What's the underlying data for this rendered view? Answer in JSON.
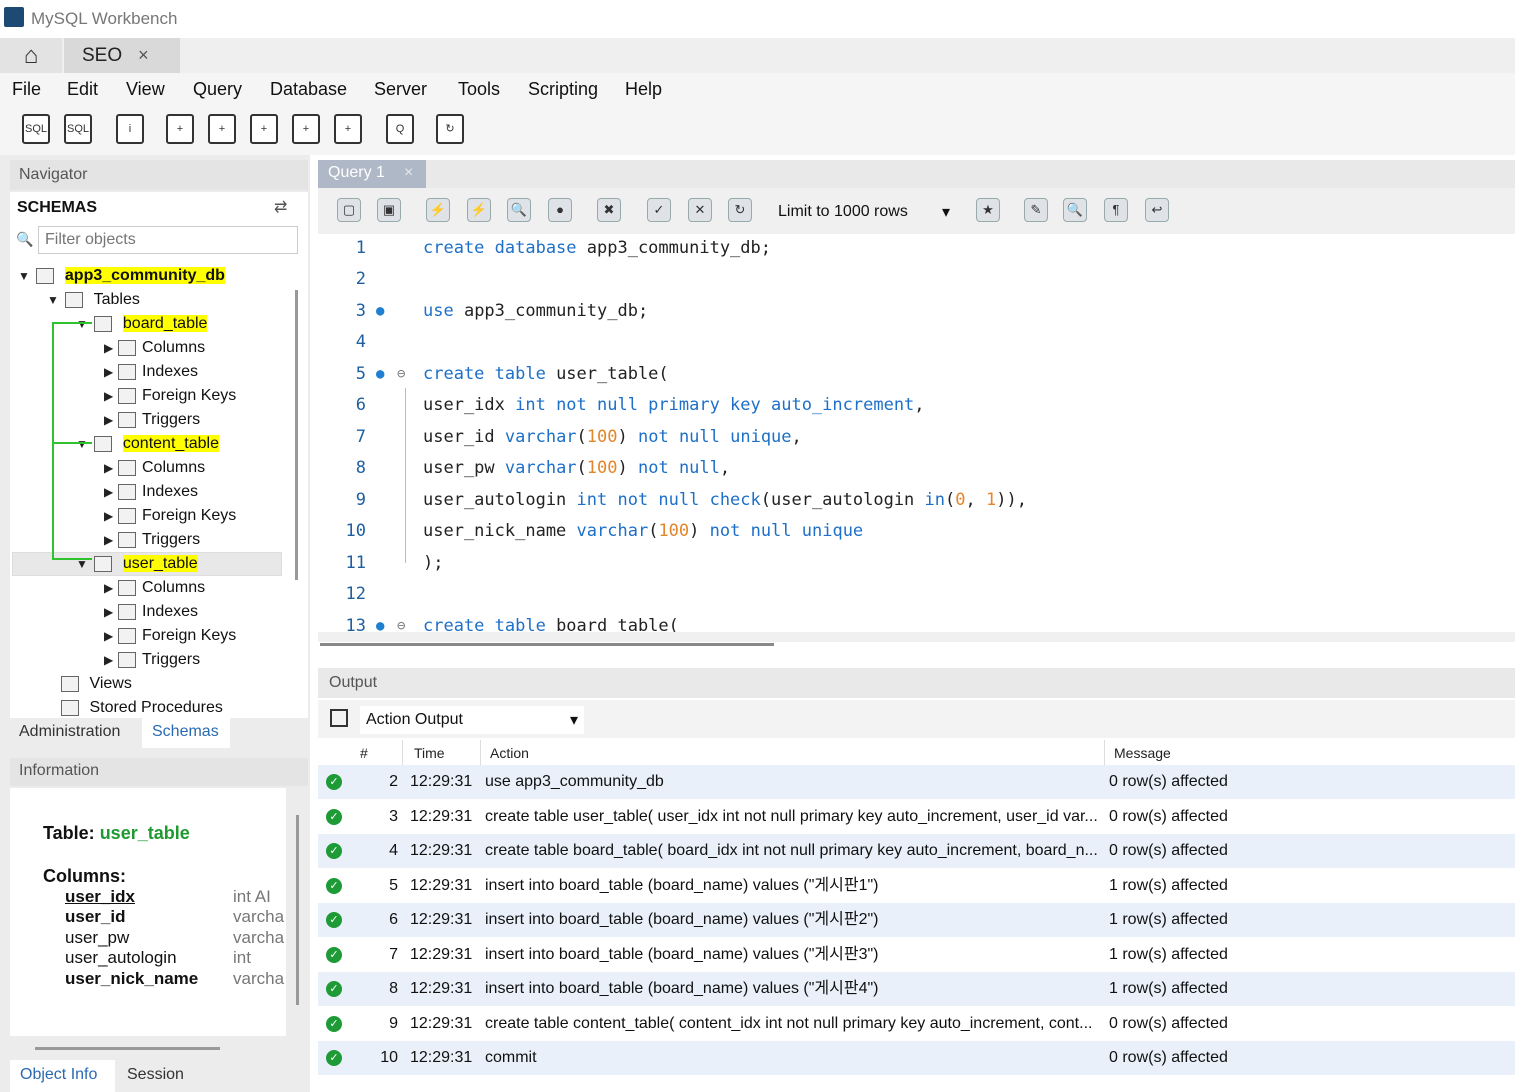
{
  "window": {
    "title": "MySQL Workbench"
  },
  "tabs": {
    "home_icon": "home-icon",
    "connection_tab": "SEO",
    "close_glyph": "×"
  },
  "menu": [
    "File",
    "Edit",
    "View",
    "Query",
    "Database",
    "Server",
    "Tools",
    "Scripting",
    "Help"
  ],
  "navigator": {
    "title": "Navigator",
    "schemas_title": "SCHEMAS",
    "filter_placeholder": "Filter objects",
    "tree": {
      "schema": "app3_community_db",
      "tables_label": "Tables",
      "tables": [
        {
          "name": "board_table",
          "children": [
            "Columns",
            "Indexes",
            "Foreign Keys",
            "Triggers"
          ]
        },
        {
          "name": "content_table",
          "children": [
            "Columns",
            "Indexes",
            "Foreign Keys",
            "Triggers"
          ]
        },
        {
          "name": "user_table",
          "children": [
            "Columns",
            "Indexes",
            "Foreign Keys",
            "Triggers"
          ]
        }
      ],
      "views_label": "Views",
      "procedures_label": "Stored Procedures"
    },
    "tabs": {
      "administration": "Administration",
      "schemas": "Schemas"
    }
  },
  "information": {
    "title": "Information",
    "table_prefix": "Table:",
    "table_name": "user_table",
    "columns_label": "Columns:",
    "columns": [
      {
        "name": "user_idx",
        "type": "int AI"
      },
      {
        "name": "user_id",
        "type": "varcha"
      },
      {
        "name": "user_pw",
        "type": "varcha"
      },
      {
        "name": "user_autologin",
        "type": "int"
      },
      {
        "name": "user_nick_name",
        "type": "varcha"
      }
    ],
    "tabs": {
      "object_info": "Object Info",
      "session": "Session"
    }
  },
  "editor": {
    "tab": "Query 1",
    "tab_close": "×",
    "limit_label": "Limit to 1000 rows",
    "lines": [
      {
        "n": "1",
        "text": "create database app3_community_db;"
      },
      {
        "n": "2",
        "text": ""
      },
      {
        "n": "3",
        "text": "use app3_community_db;"
      },
      {
        "n": "4",
        "text": ""
      },
      {
        "n": "5",
        "text": "create table user_table("
      },
      {
        "n": "6",
        "text": "user_idx int not null primary key auto_increment,"
      },
      {
        "n": "7",
        "text": "user_id varchar(100) not null unique,"
      },
      {
        "n": "8",
        "text": "user_pw varchar(100) not null,"
      },
      {
        "n": "9",
        "text": "user_autologin int not null check(user_autologin in(0, 1)),"
      },
      {
        "n": "10",
        "text": "user_nick_name varchar(100) not null unique"
      },
      {
        "n": "11",
        "text": ");"
      },
      {
        "n": "12",
        "text": ""
      },
      {
        "n": "13",
        "text": "create table board_table("
      }
    ]
  },
  "output": {
    "title": "Output",
    "mode": "Action Output",
    "columns": [
      "#",
      "Time",
      "Action",
      "Message"
    ],
    "rows": [
      {
        "n": "2",
        "time": "12:29:31",
        "action": "use app3_community_db",
        "message": "0 row(s) affected"
      },
      {
        "n": "3",
        "time": "12:29:31",
        "action": "create table user_table( user_idx int not null primary key auto_increment, user_id var...",
        "message": "0 row(s) affected"
      },
      {
        "n": "4",
        "time": "12:29:31",
        "action": "create table board_table( board_idx int not null primary key auto_increment, board_n...",
        "message": "0 row(s) affected"
      },
      {
        "n": "5",
        "time": "12:29:31",
        "action": "insert into board_table (board_name) values (\"게시판1\")",
        "message": "1 row(s) affected"
      },
      {
        "n": "6",
        "time": "12:29:31",
        "action": "insert into board_table (board_name) values (\"게시판2\")",
        "message": "1 row(s) affected"
      },
      {
        "n": "7",
        "time": "12:29:31",
        "action": "insert into board_table (board_name) values (\"게시판3\")",
        "message": "1 row(s) affected"
      },
      {
        "n": "8",
        "time": "12:29:31",
        "action": "insert into board_table (board_name) values (\"게시판4\")",
        "message": "1 row(s) affected"
      },
      {
        "n": "9",
        "time": "12:29:31",
        "action": "create table content_table( content_idx int not null primary key auto_increment, cont...",
        "message": "0 row(s) affected"
      },
      {
        "n": "10",
        "time": "12:29:31",
        "action": "commit",
        "message": "0 row(s) affected"
      }
    ]
  },
  "colors": {
    "highlight": "#ffff00",
    "keyword": "#1d6fc7",
    "number": "#e3852b",
    "ok": "#1e9a36",
    "annotation_line": "#2ec32e"
  }
}
